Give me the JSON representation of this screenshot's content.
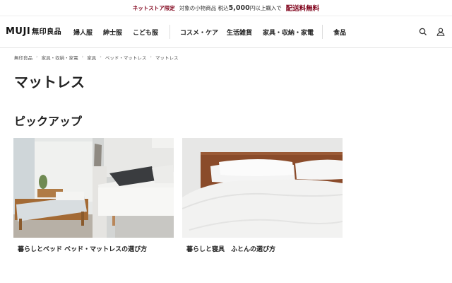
{
  "promo": {
    "tag": "ネットストア限定",
    "mid": "対象の小物商品 税込",
    "amount": "5,000",
    "after": "円以上購入で",
    "highlight": "配送料無料"
  },
  "header": {
    "logo_brand": "MUJI",
    "logo_jp": "無印良品",
    "nav": [
      "婦人服",
      "紳士服",
      "こども服",
      "コスメ・ケア",
      "生活雑貨",
      "家具・収納・家電",
      "食品"
    ]
  },
  "breadcrumb": [
    "無印良品",
    "家具・収納・家電",
    "家具",
    "ベッド・マットレス",
    "マットレス"
  ],
  "page_title": "マットレス",
  "section_title": "ピックアップ",
  "cards": [
    {
      "caption": "暮らしとベッド ベッド・マットレスの選び方"
    },
    {
      "caption": "暮らしと寝具　ふとんの選び方"
    }
  ],
  "icons": {
    "search": "search-icon",
    "account": "user-icon"
  }
}
